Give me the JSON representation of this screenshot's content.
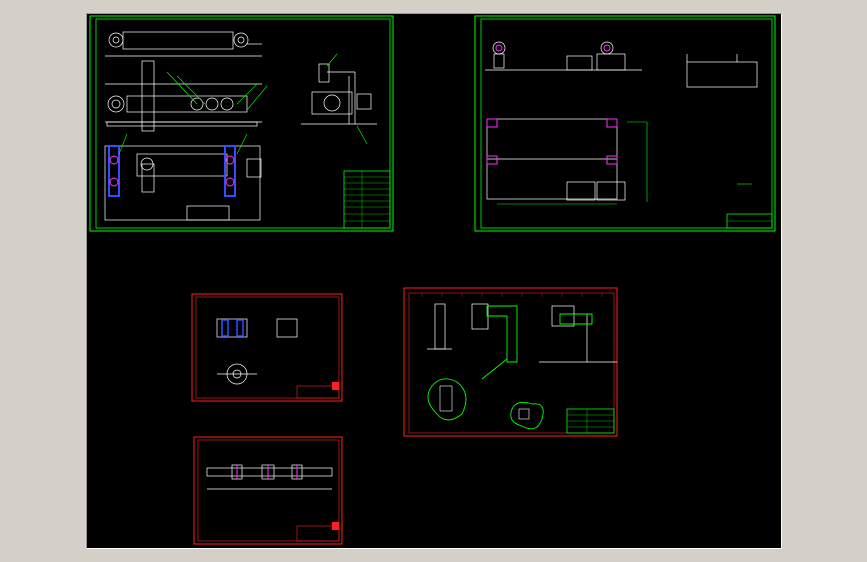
{
  "viewer": {
    "background": "#000000",
    "frame_color": "#d4d0c8"
  },
  "colors": {
    "green_sheet": "#00ff00",
    "red_sheet": "#ff2020",
    "line": "#ffffff",
    "blue": "#3050ff",
    "magenta": "#ff30ff",
    "cyan": "#00ffff",
    "yellow": "#ffff00"
  },
  "sheets": [
    {
      "id": "assembly",
      "border": "green"
    },
    {
      "id": "frame",
      "border": "green"
    },
    {
      "id": "shaft-parts",
      "border": "red"
    },
    {
      "id": "bracket-parts",
      "border": "red"
    },
    {
      "id": "long-shaft",
      "border": "red"
    }
  ]
}
